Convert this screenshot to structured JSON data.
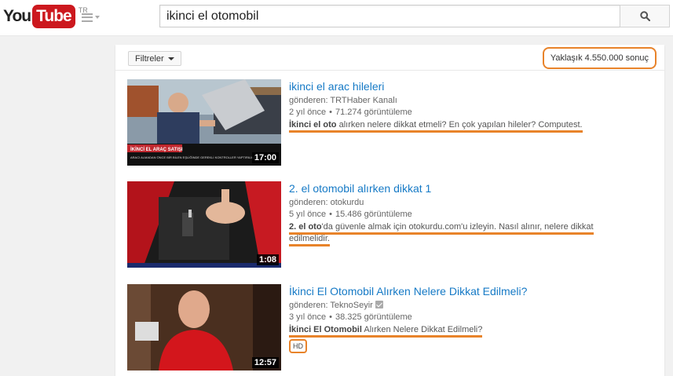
{
  "header": {
    "logo_you": "You",
    "logo_tube": "Tube",
    "logo_region": "TR",
    "search_query": "ikinci el otomobil"
  },
  "filters": {
    "label": "Filtreler",
    "result_count": "Yaklaşık 4.550.000 sonuç"
  },
  "results": [
    {
      "title": "ikinci el arac hileleri",
      "channel": "gönderen: TRTHaber Kanalı",
      "age": "2 yıl önce",
      "views": "71.274 görüntüleme",
      "desc_bold": "İkinci el oto",
      "desc_rest": " alırken nelere dikkat etmeli? En çok yapılan hileler? Computest.",
      "duration": "17:00",
      "thumb_caption_1": "İKİNCİ EL ARAÇ SATIŞI",
      "thumb_caption_2": "ARACI ALMADAN ÖNCE BİR BİLEN EŞLİĞİNDE GEREKLİ KONTROLLER YAPTIRILMALI"
    },
    {
      "title": "2. el otomobil alırken dikkat 1",
      "channel": "gönderen: otokurdu",
      "age": "5 yıl önce",
      "views": "15.486 görüntüleme",
      "desc_bold": "2. el oto",
      "desc_rest": "'da güvenle almak için otokurdu.com'u izleyin. Nasıl alınır, nelere dikkat edilmelidir.",
      "duration": "1:08"
    },
    {
      "title": "İkinci El Otomobil Alırken Nelere Dikkat Edilmeli?",
      "channel": "gönderen: TeknoSeyir",
      "age": "3 yıl önce",
      "views": "38.325 görüntüleme",
      "desc_bold": "İkinci El Otomobil",
      "desc_rest": " Alırken Nelere Dikkat Edilmeli?",
      "badge": "HD",
      "duration": "12:57"
    }
  ],
  "colors": {
    "brand_red": "#cc181e",
    "link_blue": "#167ac6",
    "annotation_orange": "#e8832a"
  },
  "icons": [
    "guide-menu-icon",
    "search-icon",
    "dropdown-caret-icon",
    "verified-check-icon"
  ]
}
